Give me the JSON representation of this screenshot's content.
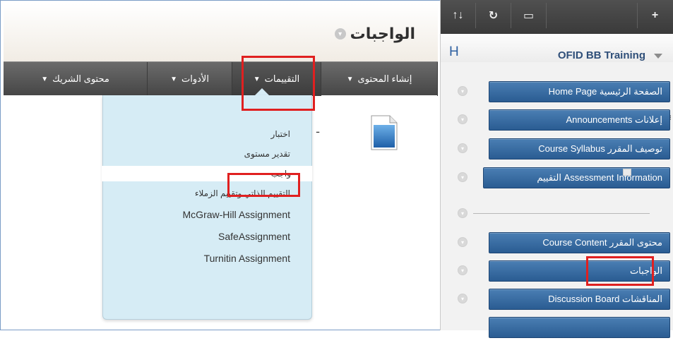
{
  "page": {
    "title": "الواجبات"
  },
  "menubar": {
    "items": [
      {
        "label": "إنشاء المحتوى",
        "chevron": "chevron-down-icon"
      },
      {
        "label": "التقييمات",
        "chevron": "chevron-down-icon"
      },
      {
        "label": "الأدوات",
        "chevron": "chevron-down-icon"
      },
      {
        "label": "محتوى الشريك",
        "chevron": "chevron-down-icon"
      }
    ]
  },
  "dropdown": {
    "items": [
      {
        "label": "اختبار"
      },
      {
        "label": "تقدير مستوى"
      },
      {
        "label": "واجب"
      },
      {
        "label": "التقييم الذاتي وتقييم الزملاء"
      },
      {
        "label": "McGraw-Hill Assignment"
      },
      {
        "label": "SafeAssignment"
      },
      {
        "label": "Turnitin Assignment"
      }
    ]
  },
  "content": {
    "stray_text": "ـ"
  },
  "sidebar": {
    "toolbar": {
      "sort_icon": "↑↓",
      "refresh_icon": "↻",
      "display_icon": "▭",
      "add_icon": "+"
    },
    "h_label": "H",
    "course_title": "OFID BB Training",
    "items": [
      {
        "label": "Home Page الصفحة الرئيسية"
      },
      {
        "label": "Announcements إعلانات"
      },
      {
        "label": "Course Syllabus توصيف المقرر"
      },
      {
        "label": "التقييم Assessment Information"
      },
      {
        "label": "Course Content محتوى المقرر"
      },
      {
        "label": "الواجبات"
      },
      {
        "label": "Discussion Board المناقشات"
      }
    ],
    "edge_mark": "⁝"
  },
  "colors": {
    "highlight_box": "#e02020",
    "menubar": "#4f4f4f",
    "dropdown_bg": "#d6ecf5",
    "sidebar_button": "#2f6199"
  }
}
